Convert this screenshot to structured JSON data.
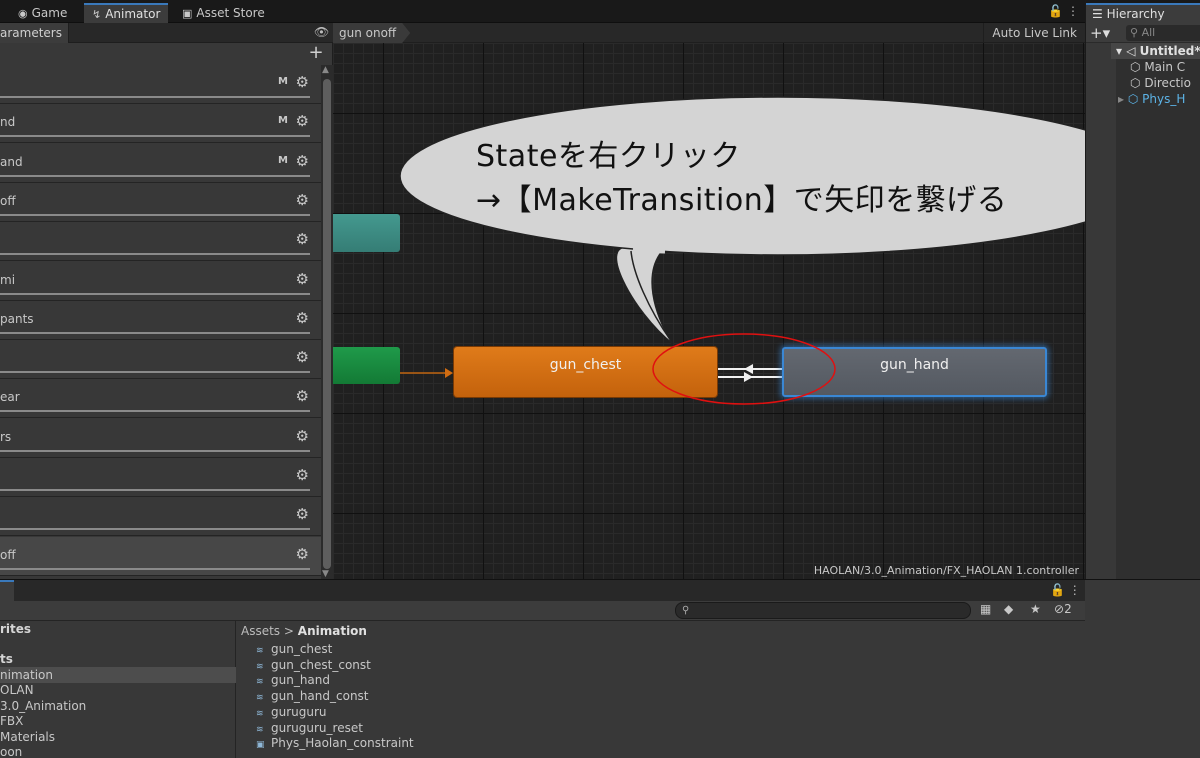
{
  "tabs": [
    {
      "label": "Game",
      "icon": "gamepad-icon"
    },
    {
      "label": "Animator",
      "icon": "animator-icon",
      "active": true
    },
    {
      "label": "Asset Store",
      "icon": "bag-icon"
    }
  ],
  "parameters": {
    "tab_label": "arameters",
    "items": [
      {
        "name": "",
        "badge": "M"
      },
      {
        "name": "nd",
        "badge": "M"
      },
      {
        "name": "and",
        "badge": "M"
      },
      {
        "name": "off",
        "badge": ""
      },
      {
        "name": "",
        "badge": ""
      },
      {
        "name": "mi",
        "badge": ""
      },
      {
        "name": "pants",
        "badge": ""
      },
      {
        "name": "",
        "badge": ""
      },
      {
        "name": "ear",
        "badge": ""
      },
      {
        "name": "rs",
        "badge": ""
      },
      {
        "name": "",
        "badge": ""
      },
      {
        "name": "",
        "badge": ""
      },
      {
        "name": "off",
        "badge": "",
        "selected": true
      }
    ]
  },
  "graph": {
    "breadcrumb": "gun onoff",
    "auto_live_link": "Auto Live Link",
    "controller_path": "HAOLAN/3.0_Animation/FX_HAOLAN 1.controller",
    "states": {
      "chest": "gun_chest",
      "hand": "gun_hand"
    }
  },
  "callout": {
    "line1": "Stateを右クリック",
    "line2": "→【MakeTransition】で矢印を繋げる"
  },
  "hierarchy": {
    "tab_label": "Hierarchy",
    "search_placeholder": "All",
    "items": [
      {
        "label": "Untitled*",
        "root": true
      },
      {
        "label": "Main C"
      },
      {
        "label": "Directio"
      },
      {
        "label": "Phys_H",
        "blue": true
      }
    ]
  },
  "project": {
    "hidden_count": "2",
    "left_items": [
      {
        "label": "rites",
        "bold": true
      },
      {
        "label": "ts",
        "bold": true
      },
      {
        "label": "nimation",
        "selected": true
      },
      {
        "label": "OLAN"
      },
      {
        "label": "3.0_Animation"
      },
      {
        "label": "FBX"
      },
      {
        "label": "Materials"
      },
      {
        "label": "oon"
      }
    ],
    "breadcrumb": {
      "root": "Assets",
      "separator": ">",
      "current": "Animation"
    },
    "assets": [
      {
        "name": "gun_chest",
        "icon": "anim-clip-icon"
      },
      {
        "name": "gun_chest_const",
        "icon": "anim-clip-icon"
      },
      {
        "name": "gun_hand",
        "icon": "anim-clip-icon"
      },
      {
        "name": "gun_hand_const",
        "icon": "anim-clip-icon"
      },
      {
        "name": "guruguru",
        "icon": "anim-clip-icon"
      },
      {
        "name": "guruguru_reset",
        "icon": "anim-clip-icon"
      },
      {
        "name": "Phys_Haolan_constraint",
        "icon": "constraint-icon"
      }
    ]
  },
  "colors": {
    "state_chest": "#df7b1a",
    "state_hand": "#5a5f67",
    "selection_outline": "#3a87d4",
    "annotation_ellipse": "#e01010"
  }
}
